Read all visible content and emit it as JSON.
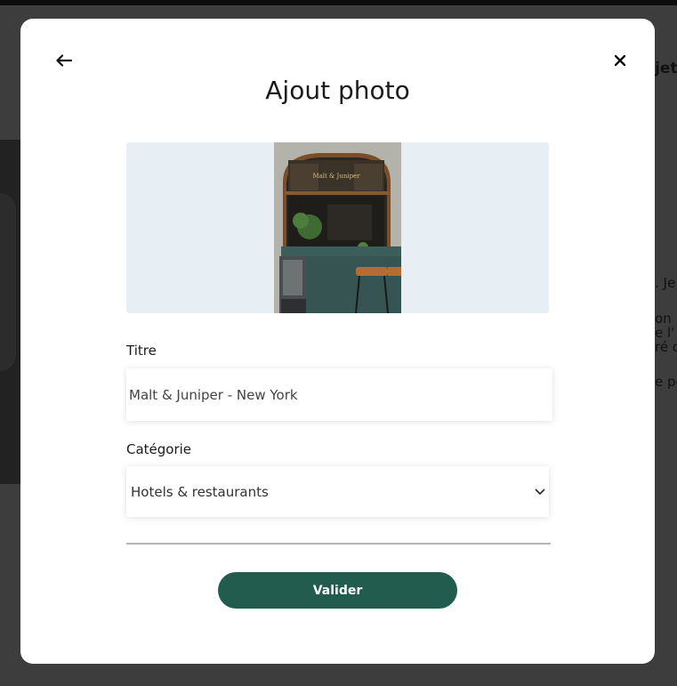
{
  "background": {
    "snippets": [
      "jet",
      ". Je",
      "on",
      "e l'",
      "ré d",
      "e pe"
    ]
  },
  "modal": {
    "title": "Ajout photo",
    "back_icon": "arrow-left-icon",
    "close_icon": "close-icon",
    "photo": {
      "sign_text": "Malt & Juniper"
    },
    "fields": {
      "title_label": "Titre",
      "title_value": "Malt & Juniper - New York",
      "category_label": "Catégorie",
      "category_value": "Hotels & restaurants",
      "category_icon": "chevron-down-icon"
    },
    "submit_label": "Valider"
  },
  "colors": {
    "accent": "#215c4e",
    "photo_bg": "#e8eff4",
    "overlay": "#3d3d3d"
  }
}
